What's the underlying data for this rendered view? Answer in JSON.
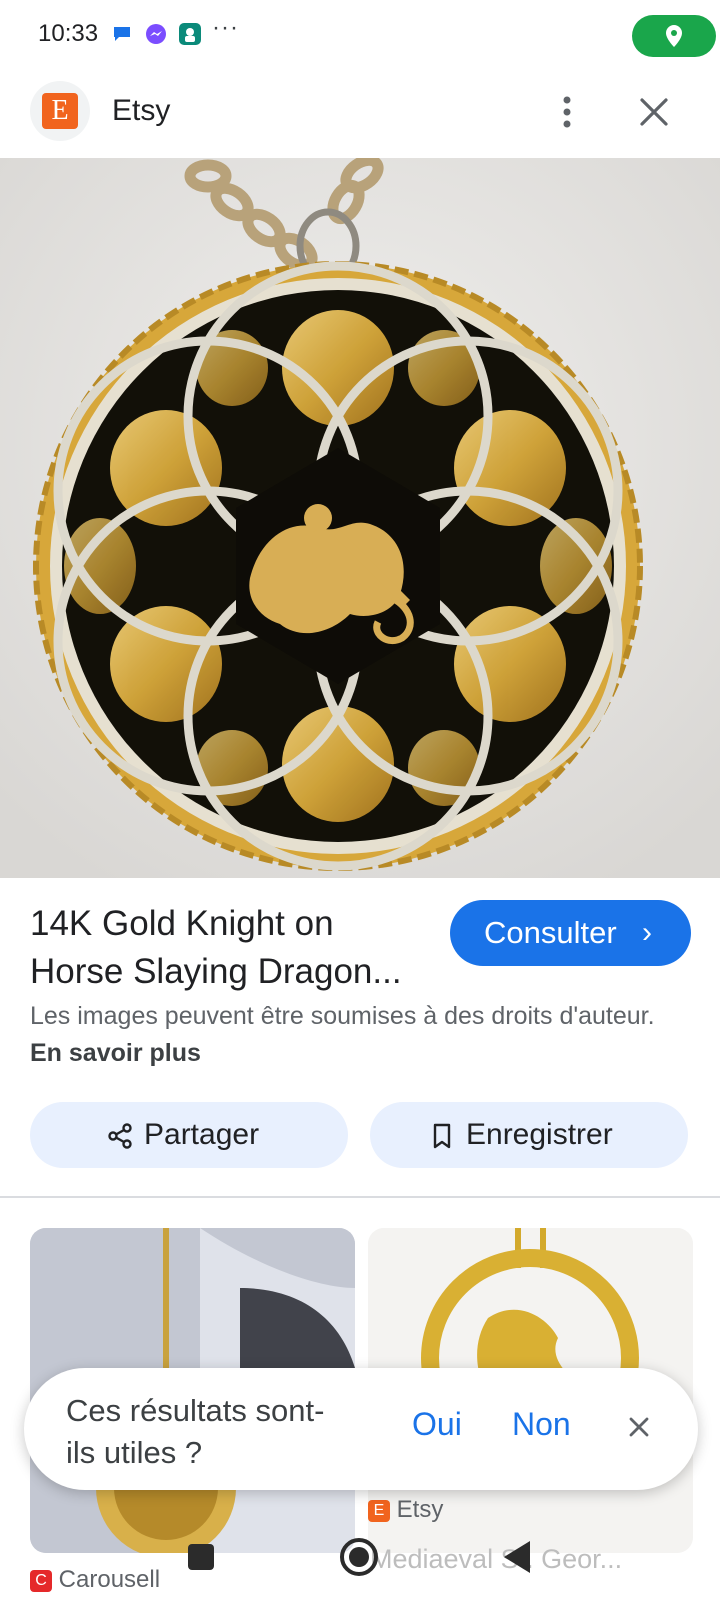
{
  "status_bar": {
    "time": "10:33",
    "more": "···",
    "icons": [
      "chat-icon",
      "messenger-icon",
      "app-icon",
      "location-icon"
    ],
    "location_color": "#1aa64b"
  },
  "header": {
    "site_logo_letter": "E",
    "site_name": "Etsy"
  },
  "result": {
    "title": "14K Gold Knight on Horse Slaying Dragon...",
    "visit_label": "Consulter",
    "visit_chevron": "›",
    "copyright_text": "Les images peuvent être soumises à des droits d'auteur.",
    "learn_more": "En savoir plus",
    "share_label": "Partager",
    "save_label": "Enregistrer"
  },
  "related": [
    {
      "source": "Carousell",
      "source_icon_letter": "C",
      "source_color": "#e5292a"
    },
    {
      "source": "Etsy",
      "title": "Mediaeval St. Geor...",
      "source_icon_letter": "E",
      "source_color": "#f1641e"
    }
  ],
  "feedback": {
    "question": "Ces résultats sont-ils utiles ?",
    "yes": "Oui",
    "no": "Non"
  },
  "colors": {
    "accent": "#1a73e8",
    "button_bg": "#e8f0fe",
    "etsy": "#f1641e"
  }
}
